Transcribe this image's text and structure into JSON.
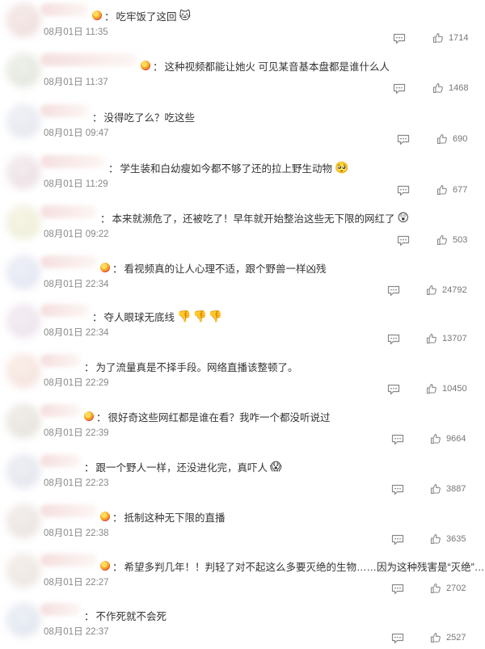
{
  "comments": [
    {
      "text": "吃牢饭了这回",
      "emoji": "🐱",
      "time": "08月01日 11:35",
      "likes": "1714",
      "badge": true
    },
    {
      "text": "这种视频都能让她火 可见某音基本盘都是谁什么人",
      "emoji": "",
      "time": "08月01日 11:37",
      "likes": "1468",
      "badge": true
    },
    {
      "text": "没得吃了么？吃这些",
      "emoji": "",
      "time": "08月01日 09:47",
      "likes": "690",
      "badge": false
    },
    {
      "text": "学生装和白幼瘦如今都不够了还的拉上野生动物",
      "emoji": "🥺",
      "time": "08月01日 11:29",
      "likes": "677",
      "badge": false
    },
    {
      "text": "本来就濒危了，还被吃了！早年就开始整治这些无下限的网红了",
      "emoji": "😲",
      "time": "08月01日 09:22",
      "likes": "503",
      "badge": false
    },
    {
      "text": "看视频真的让人心理不适，跟个野兽一样凶残",
      "emoji": "",
      "time": "08月01日 22:34",
      "likes": "24792",
      "badge": true
    },
    {
      "text": "夺人眼球无底线",
      "emoji": "👎👎👎",
      "time": "08月01日 22:34",
      "likes": "13707",
      "badge": false
    },
    {
      "text": "为了流量真是不择手段。网络直播该整顿了。",
      "emoji": "",
      "time": "08月01日 22:29",
      "likes": "10450",
      "badge": false
    },
    {
      "text": "很好奇这些网红都是谁在看？我咋一个都没听说过",
      "emoji": "",
      "time": "08月01日 22:39",
      "likes": "9664",
      "badge": true
    },
    {
      "text": "跟一个野人一样，还没进化完，真吓人",
      "emoji": "😱",
      "time": "08月01日 22:23",
      "likes": "3887",
      "badge": false
    },
    {
      "text": "抵制这种无下限的直播",
      "emoji": "",
      "time": "08月01日 22:38",
      "likes": "3635",
      "badge": true
    },
    {
      "text": "希望多判几年！！判轻了对不起这么多要灭绝的生物……因为这种残害是“灭绝”……",
      "emoji": "",
      "time": "08月01日 22:27",
      "likes": "2702",
      "badge": true
    },
    {
      "text": "不作死就不会死",
      "emoji": "",
      "time": "08月01日 22:37",
      "likes": "2527",
      "badge": false
    }
  ]
}
